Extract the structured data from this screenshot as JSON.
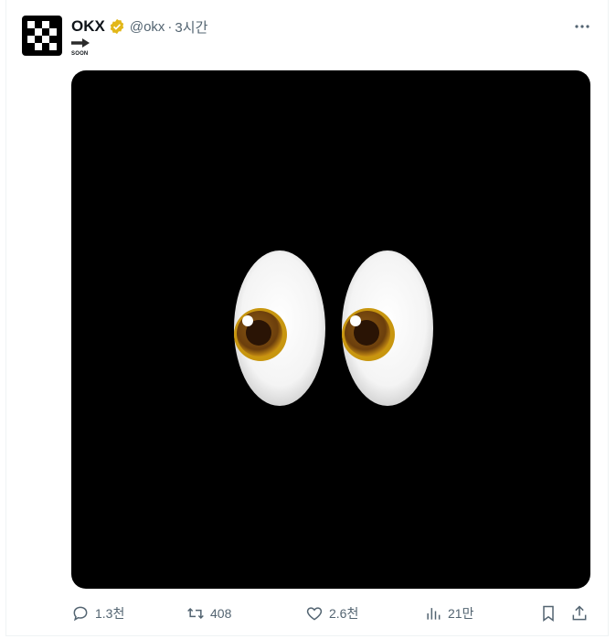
{
  "author": {
    "name": "OKX",
    "handle": "@okx",
    "separator": "·",
    "time": "3시간",
    "avatar_icon": "okx-logo-icon",
    "verified_color": "#e2b719"
  },
  "tweet": {
    "arrow_icon": "right-arrow-icon",
    "soon_label": "SOON"
  },
  "media": {
    "description_icon": "eyes-emoji-icon",
    "background": "#000000"
  },
  "actions": {
    "reply_count": "1.3천",
    "retweet_count": "408",
    "like_count": "2.6천",
    "views_count": "21만"
  },
  "colors": {
    "text_primary": "#0f1419",
    "text_secondary": "#536471"
  }
}
